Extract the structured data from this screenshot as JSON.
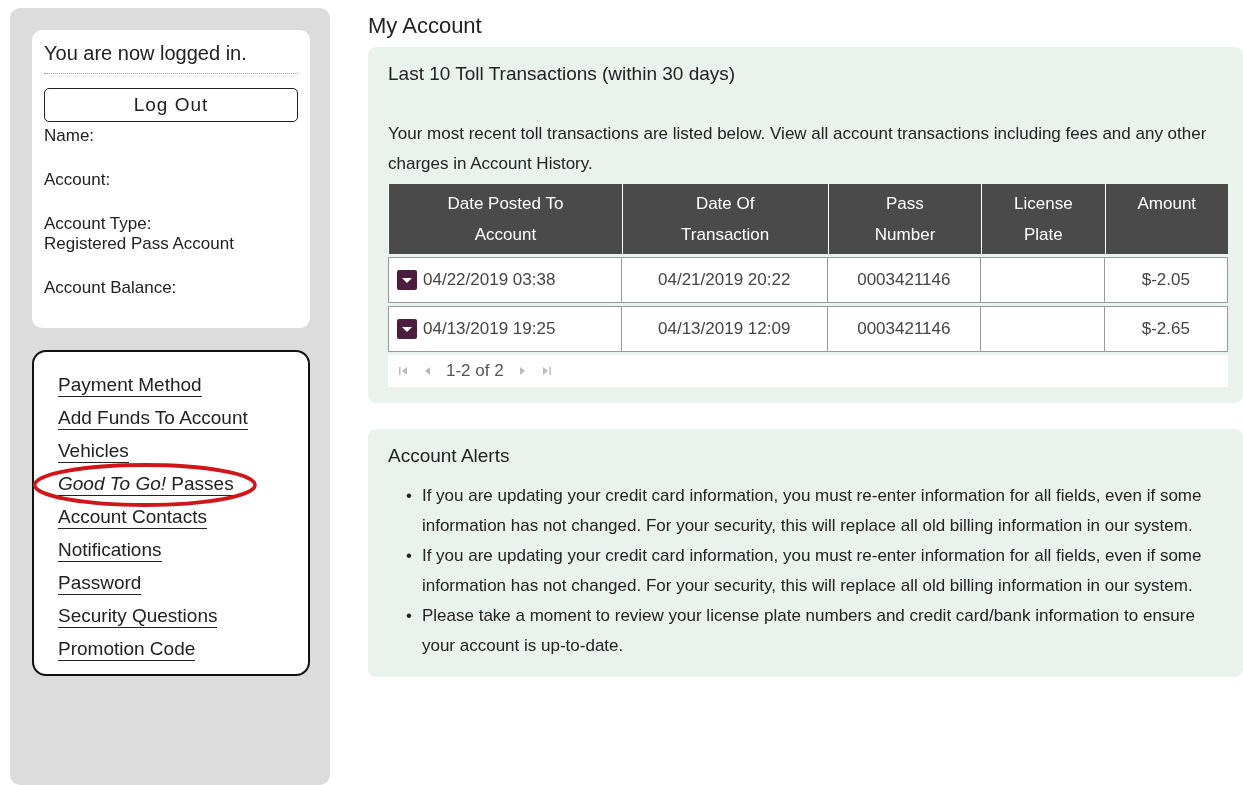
{
  "sidebar": {
    "status": "You are now logged in.",
    "logout_button": "Log Out",
    "fields": [
      {
        "label": "Name:"
      },
      {
        "label": "Account:"
      },
      {
        "label": "Account Type:",
        "value": "Registered Pass Account"
      },
      {
        "label": "Account Balance:"
      }
    ],
    "nav": [
      {
        "label": "Payment Method",
        "highlighted": false
      },
      {
        "label": "Add Funds To Account",
        "highlighted": false
      },
      {
        "label": "Vehicles",
        "highlighted": false
      },
      {
        "label": "*Good To Go!* Passes",
        "highlighted": true
      },
      {
        "label": "Account Contacts",
        "highlighted": false
      },
      {
        "label": "Notifications",
        "highlighted": false
      },
      {
        "label": "Password",
        "highlighted": false
      },
      {
        "label": "Security Questions",
        "highlighted": false
      },
      {
        "label": "Promotion Code",
        "highlighted": false
      }
    ]
  },
  "title": "My Account",
  "transactions": {
    "heading": "Last 10 Toll Transactions (within 30 days)",
    "intro": "Your most recent toll transactions are listed below. View all account transactions including fees and any other charges in Account History.",
    "columns": [
      "Date Posted To Account",
      "Date Of Transaction",
      "Pass Number",
      "License Plate",
      "Amount"
    ],
    "rows": [
      [
        "04/22/2019 03:38",
        "04/21/2019 20:22",
        "0003421146",
        "",
        "$-2.05"
      ],
      [
        "04/13/2019 19:25",
        "04/13/2019 12:09",
        "0003421146",
        "",
        "$-2.65"
      ]
    ],
    "pager": "1-2 of 2"
  },
  "alerts": {
    "heading": "Account Alerts",
    "marker": "•",
    "items": [
      "If you are updating your credit card information, you must re-enter information for all fields, even if some information has not changed. For your security, this will replace all old billing information in our system.",
      "If you are updating your credit card information, you must re-enter information for all fields, even if some information has not changed. For your security, this will replace all old billing information in our system.",
      "Please take a moment to review your license plate numbers and credit card/bank information to ensure your account is up-to-date."
    ]
  }
}
